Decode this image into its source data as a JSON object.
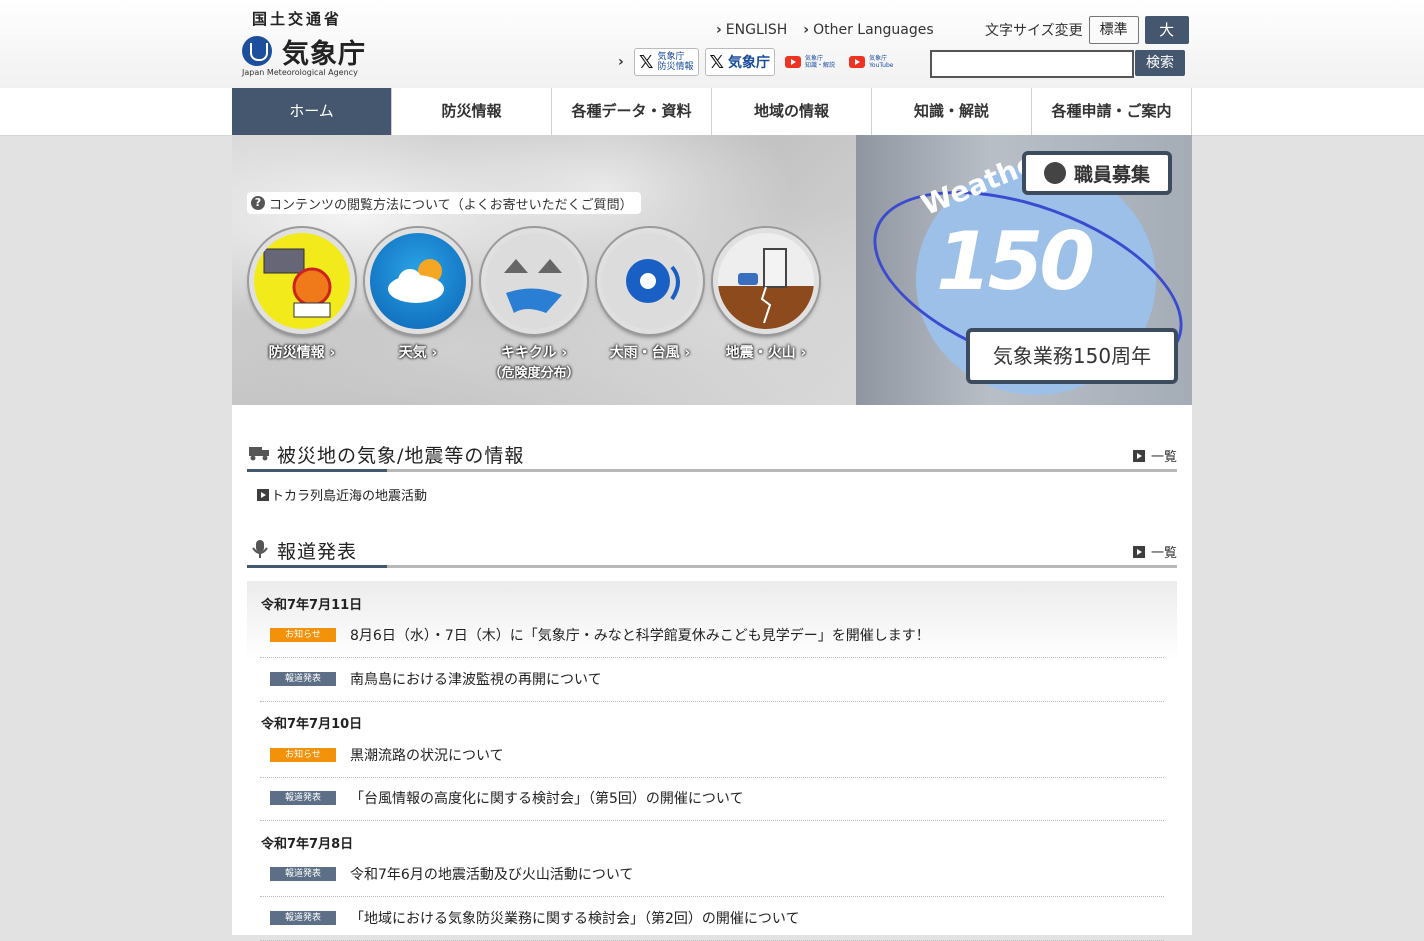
{
  "header": {
    "ministry": "国土交通省",
    "agency": "気象庁",
    "agency_en": "Japan Meteorological Agency",
    "lang_links": [
      "ENGLISH",
      "Other Languages"
    ],
    "fontsize_label": "文字サイズ変更",
    "fontsize_standard": "標準",
    "fontsize_large": "大",
    "social": {
      "x_disaster": "気象庁\n防災情報",
      "x_main": "気象庁",
      "yt_knowledge": "気象庁\n知識・解説",
      "yt_main": "気象庁\nYouTube"
    },
    "search_placeholder": "",
    "search_button": "検索"
  },
  "nav": [
    "ホーム",
    "防災情報",
    "各種データ・資料",
    "地域の情報",
    "知識・解説",
    "各種申請・ご案内"
  ],
  "hero": {
    "faq": "コンテンツの閲覧方法について（よくお寄せいただくご質問）",
    "tiles": [
      {
        "label": "防災情報",
        "sub": ""
      },
      {
        "label": "天気",
        "sub": ""
      },
      {
        "label": "キキクル",
        "sub": "（危険度分布）"
      },
      {
        "label": "大雨・台風",
        "sub": ""
      },
      {
        "label": "地震・火山",
        "sub": ""
      }
    ],
    "banner": {
      "recruit": "職員募集",
      "weather_text": "Weather",
      "number": "150",
      "anniversary": "気象業務150周年"
    }
  },
  "disaster_section": {
    "title": "被災地の気象/地震等の情報",
    "more": "一覧",
    "items": [
      "トカラ列島近海の地震活動"
    ]
  },
  "press_section": {
    "title": "報道発表",
    "more": "一覧",
    "groups": [
      {
        "date": "令和7年7月11日",
        "items": [
          {
            "badge": "お知らせ",
            "type": "orange",
            "text": "8月6日（水）・7日（木）に「気象庁・みなと科学館夏休みこども見学デー」を開催します！"
          },
          {
            "badge": "報道発表",
            "type": "slate",
            "text": "南鳥島における津波監視の再開について"
          }
        ]
      },
      {
        "date": "令和7年7月10日",
        "items": [
          {
            "badge": "お知らせ",
            "type": "orange",
            "text": "黒潮流路の状況について"
          },
          {
            "badge": "報道発表",
            "type": "slate",
            "text": "「台風情報の高度化に関する検討会」（第5回）の開催について"
          }
        ]
      },
      {
        "date": "令和7年7月8日",
        "items": [
          {
            "badge": "報道発表",
            "type": "slate",
            "text": "令和7年6月の地震活動及び火山活動について"
          },
          {
            "badge": "報道発表",
            "type": "slate",
            "text": "「地域における気象防災業務に関する検討会」（第2回）の開催について"
          }
        ]
      }
    ]
  },
  "colors": {
    "nav_active": "#45576e",
    "badge_notice": "#f2920a",
    "badge_press": "#5c6f86"
  }
}
